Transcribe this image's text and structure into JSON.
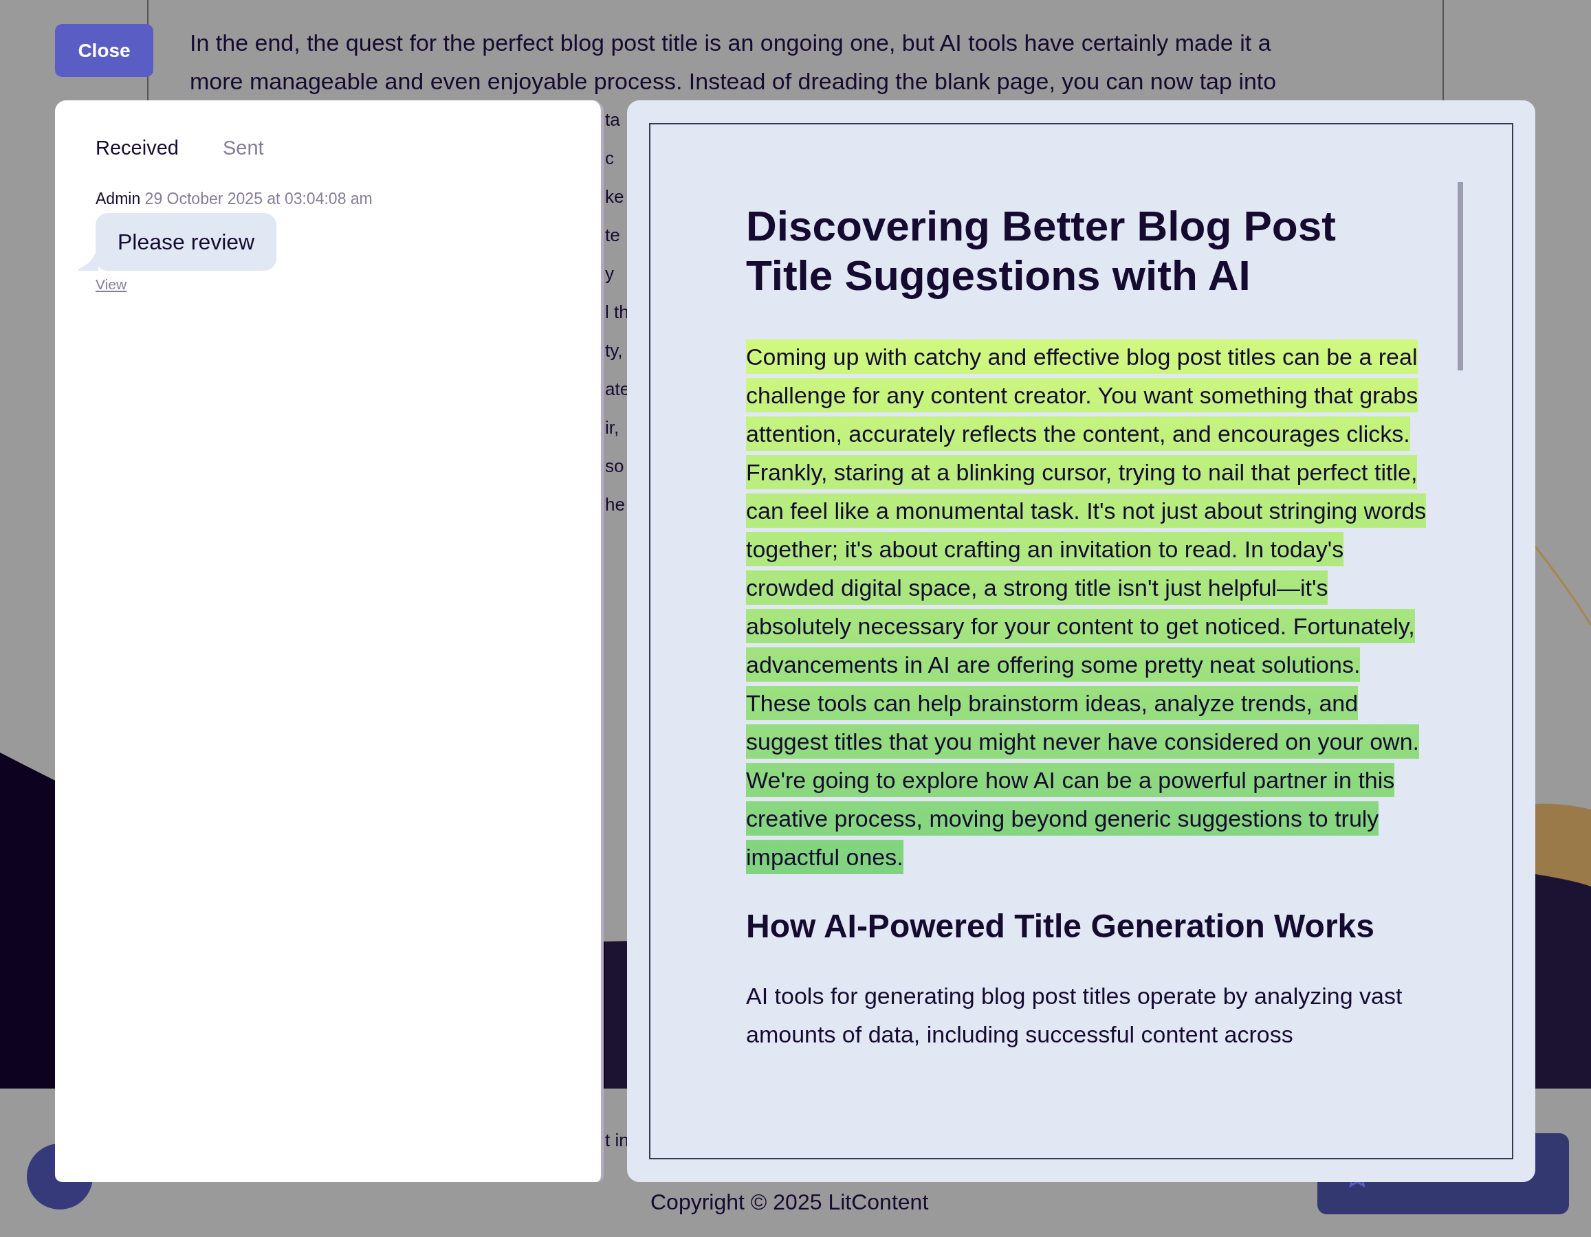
{
  "background_page": {
    "intro_lines": [
      "In the end, the quest for the perfect blog post title is an ongoing one, but AI tools have certainly made it a",
      "more manageable and even enjoyable process. Instead of dreading the blank page, you can now tap into"
    ],
    "partial_lines": [
      "ta",
      "c",
      "ke",
      "te",
      "y",
      "l th",
      "ty,",
      "ate",
      "ir,",
      "so",
      "he"
    ],
    "footer_partial": "t in",
    "copyright": "Copyright © 2025 LitContent"
  },
  "close_button": "Close",
  "comments_panel": {
    "tabs": [
      {
        "label": "Received",
        "selected": true
      },
      {
        "label": "Sent",
        "selected": false
      }
    ],
    "messages": [
      {
        "author": "Admin",
        "timestamp": "29 October 2025 at 03:04:08 am",
        "text": "Please review",
        "link": "View"
      }
    ]
  },
  "document_preview": {
    "title": "Discovering Better Blog Post Title Suggestions with AI",
    "blocks": [
      {
        "kind": "paragraph",
        "highlighted": true,
        "text": "Coming up with catchy and effective blog post titles can be a real challenge for any content creator. You want something that grabs attention, accurately reflects the content, and encourages clicks. Frankly, staring at a blinking cursor, trying to nail that perfect title, can feel like a monumental task. It's not just about stringing words together; it's about crafting an invitation to read. In today's crowded digital space, a strong title isn't just helpful—it's absolutely necessary for your content to get noticed. Fortunately, advancements in AI are offering some pretty neat solutions. These tools can help brainstorm ideas, analyze trends, and suggest titles that you might never have considered on your own. We're going to explore how AI can be a powerful partner in this creative process, moving beyond generic suggestions to truly impactful ones."
      },
      {
        "kind": "heading",
        "text": "How AI-Powered Title Generation Works"
      },
      {
        "kind": "paragraph",
        "highlighted": false,
        "text": "AI tools for generating blog post titles operate by analyzing vast amounts of data, including successful content across"
      }
    ]
  }
}
